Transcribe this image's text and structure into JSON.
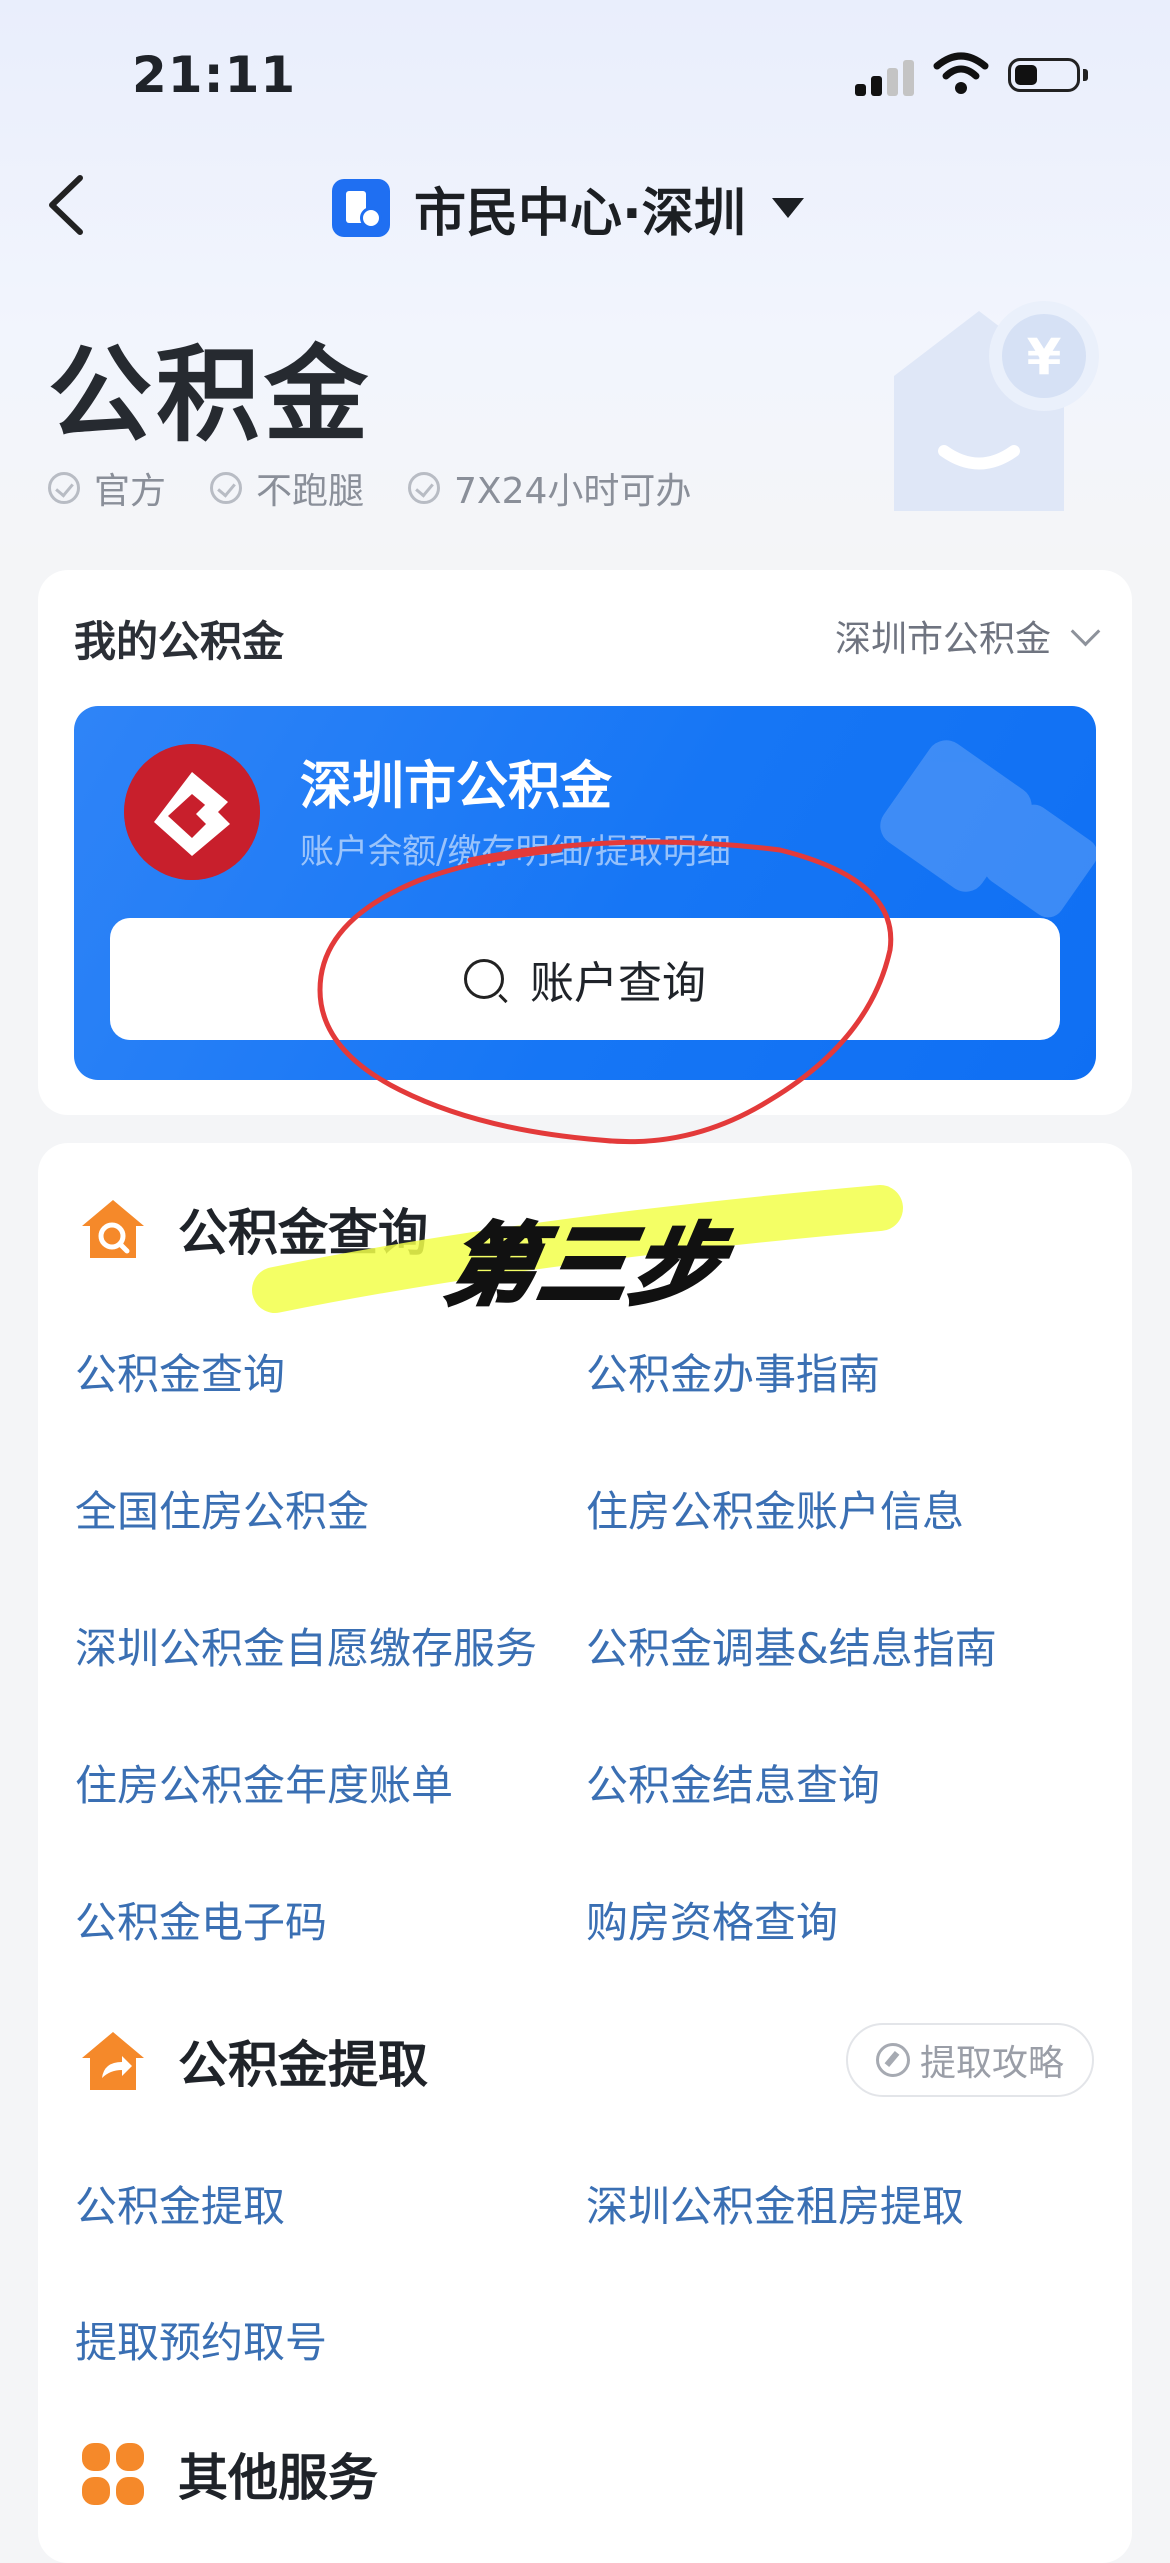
{
  "status_bar": {
    "time": "21:11"
  },
  "nav": {
    "title": "市民中心·深圳"
  },
  "hero": {
    "title": "公积金",
    "tags": [
      "官方",
      "不跑腿",
      "7X24小时可办"
    ]
  },
  "my_fund": {
    "label": "我的公积金",
    "city_select": "深圳市公积金",
    "card": {
      "title": "深圳市公积金",
      "subtitle": "账户余额/缴存明细/提取明细",
      "button": "账户查询"
    }
  },
  "annotation": {
    "step_text": "第三步"
  },
  "sections": {
    "query": {
      "title": "公积金查询",
      "links": [
        "公积金查询",
        "公积金办事指南",
        "全国住房公积金",
        "住房公积金账户信息",
        "深圳公积金自愿缴存服务",
        "公积金调基&结息指南",
        "住房公积金年度账单",
        "公积金结息查询",
        "公积金电子码",
        "购房资格查询"
      ]
    },
    "withdraw": {
      "title": "公积金提取",
      "strategy": "提取攻略",
      "links": [
        "公积金提取",
        "深圳公积金租房提取",
        "提取预约取号"
      ]
    },
    "other": {
      "title": "其他服务"
    }
  },
  "colors": {
    "accent": "#1676f5",
    "link": "#3a6fb3",
    "orange": "#f5892a",
    "annotation_red": "#e33a3a",
    "highlight": "#f2ff4a"
  }
}
